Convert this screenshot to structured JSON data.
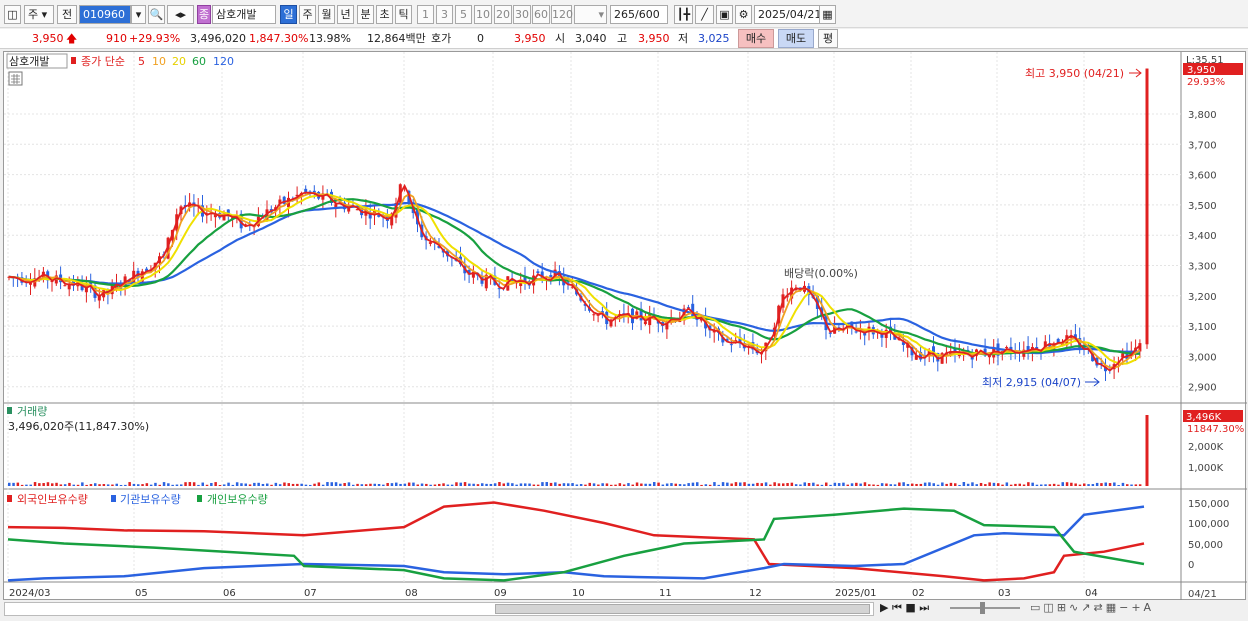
{
  "toolbar": {
    "market": "주",
    "prev_label": "전",
    "code": "010960",
    "stock_name": "삼호개발",
    "stock_badge": "종",
    "periods": [
      "일",
      "주",
      "월",
      "년",
      "분",
      "초",
      "틱"
    ],
    "active_period": "일",
    "intervals": [
      "1",
      "3",
      "5",
      "10",
      "20",
      "30",
      "60",
      "120"
    ],
    "count": "265",
    "count_total": "/600",
    "date": "2025/04/21"
  },
  "quote": {
    "price": "3,950",
    "change": "910",
    "change_pct": "+29.93%",
    "volume": "3,496,020",
    "volume_pct": "1,847.30%",
    "turnover_pct": "13.98%",
    "amount": "12,864백만",
    "hoga_label": "호가",
    "hoga_value": "0",
    "ask_value": "3,950",
    "open_label": "시",
    "open_value": "3,040",
    "high_label": "고",
    "high_value": "3,950",
    "low_label": "저",
    "low_value": "3,025",
    "buy_label": "매수",
    "sell_label": "매도",
    "avg_label": "평"
  },
  "price_panel": {
    "name_tag": "삼호개발",
    "ma_title": "종가 단순",
    "ma_periods": [
      {
        "label": "5",
        "color": "#e02020"
      },
      {
        "label": "10",
        "color": "#f0a020"
      },
      {
        "label": "20",
        "color": "#f0e000"
      },
      {
        "label": "60",
        "color": "#18a040"
      },
      {
        "label": "120",
        "color": "#2a62e0"
      }
    ],
    "right_top": "L:35.51",
    "current_box": "3,950",
    "current_pct": "29.93%",
    "high_note": "최고 3,950 (04/21)",
    "low_note": "최저 2,915 (04/07)",
    "dividend_note": "배당락(0.00%)",
    "y_ticks": [
      "3,800",
      "3,700",
      "3,600",
      "3,500",
      "3,400",
      "3,300",
      "3,200",
      "3,100",
      "3,000",
      "2,900"
    ]
  },
  "volume_panel": {
    "title": "거래량",
    "info": "3,496,020주(11,847.30%)",
    "current_box": "3,496K",
    "current_pct": "11847.30%",
    "y_ticks": [
      "2,000K",
      "1,000K"
    ]
  },
  "holding_panel": {
    "legend": [
      {
        "label": "외국인보유수량",
        "color": "#e02020"
      },
      {
        "label": "기관보유수량",
        "color": "#2a62e0"
      },
      {
        "label": "개인보유수량",
        "color": "#18a040"
      }
    ],
    "y_ticks": [
      "150,000",
      "100,000",
      "50,000",
      "0"
    ]
  },
  "x_axis": {
    "labels": [
      "2024/03",
      "05",
      "06",
      "07",
      "08",
      "09",
      "10",
      "11",
      "12",
      "2025/01",
      "02",
      "03",
      "04"
    ],
    "right_label": "04/21"
  },
  "colors": {
    "up": "#e02020",
    "down": "#2a62e0",
    "ma5": "#e02020",
    "ma10": "#f0a020",
    "ma20": "#f0e000",
    "ma60": "#18a040",
    "ma120": "#2a62e0"
  }
}
